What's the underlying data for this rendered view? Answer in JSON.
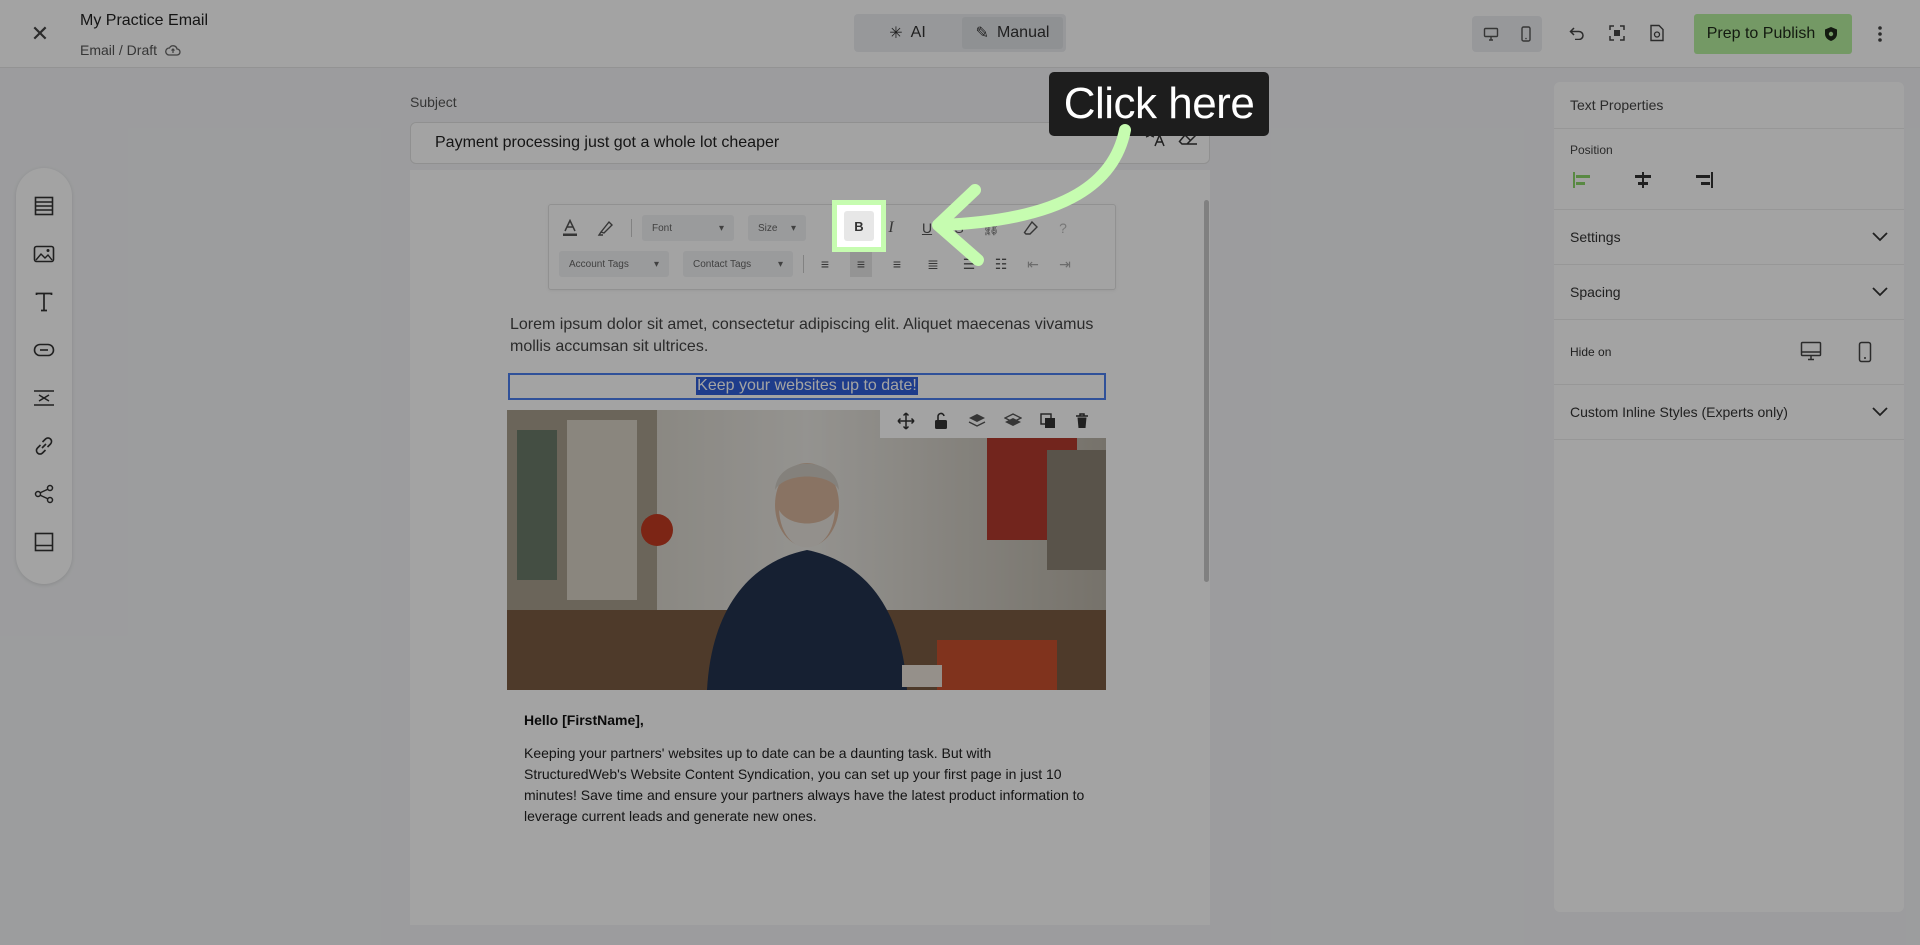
{
  "header": {
    "title": "My Practice Email",
    "breadcrumb": "Email / Draft",
    "modes": [
      {
        "label": "AI",
        "icon": "sparkle-icon"
      },
      {
        "label": "Manual",
        "icon": "pencil-icon"
      }
    ],
    "publish_label": "Prep to Publish"
  },
  "subject": {
    "label": "Subject",
    "value": "Payment processing just got a whole lot cheaper"
  },
  "toolbar": {
    "font_placeholder": "Font",
    "size_placeholder": "Size",
    "bold_label": "B",
    "account_tags": "Account Tags",
    "contact_tags": "Contact Tags"
  },
  "email": {
    "intro": "Lorem ipsum dolor sit amet, consectetur adipiscing elit. Aliquet maecenas vivamus mollis accumsan sit ultrices.",
    "headline": "Keep your websites up to date!",
    "greeting": "Hello [FirstName],",
    "body": "Keeping your partners' websites up to date can be a daunting task. But with StructuredWeb's Website Content Syndication, you can set up your first page in just 10 minutes! Save time and ensure your partners always have the latest product information to leverage current leads and generate new ones."
  },
  "panel": {
    "title": "Text Properties",
    "position_label": "Position",
    "sections": [
      "Settings",
      "Spacing"
    ],
    "hide_on_label": "Hide on",
    "custom_styles": "Custom Inline Styles (Experts only)"
  },
  "callout": {
    "text": "Click here"
  },
  "colors": {
    "publish": "#b6ef9e",
    "highlight": "#c6fcb0",
    "selection": "#2f5fd9"
  }
}
